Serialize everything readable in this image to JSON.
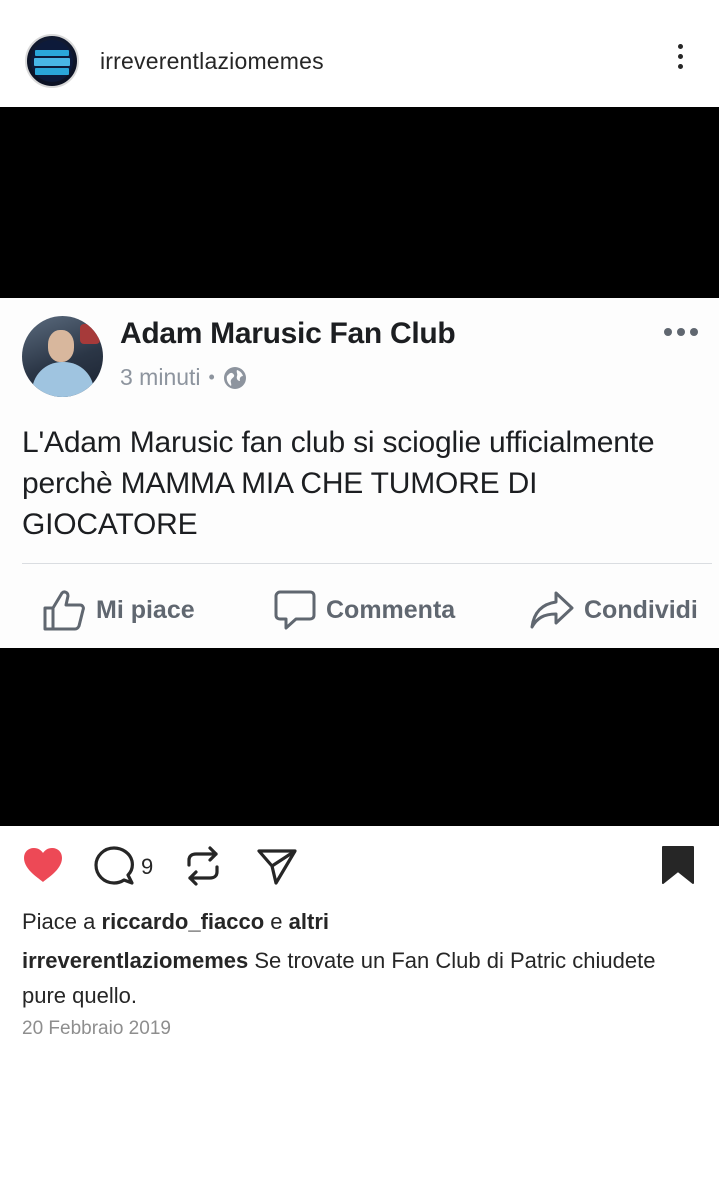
{
  "header": {
    "username": "irreverentlaziomemes",
    "avatar_icon": "profile-avatar-icon",
    "more_icon": "more-vertical-icon"
  },
  "fb_post": {
    "page_name": "Adam Marusic Fan Club",
    "time": "3 minuti",
    "separator": "•",
    "text": "L'Adam Marusic fan club si scioglie ufficialmente perchè MAMMA MIA CHE TUMORE DI GIOCATORE",
    "actions": {
      "like": "Mi piace",
      "comment": "Commenta",
      "share": "Condividi"
    },
    "colors": {
      "meta": "#8d949e",
      "action": "#606770",
      "text": "#1c1e21"
    }
  },
  "actions": {
    "liked": true,
    "comment_count": "9",
    "heart_color": "#ed4956"
  },
  "likes": {
    "prefix": "Piace a",
    "user": "riccardo_fiacco",
    "conjunction": "e",
    "others": "altri"
  },
  "caption": {
    "username": "irreverentlaziomemes",
    "text": "Se trovate un Fan Club di Patric chiudete pure quello."
  },
  "date": "20 Febbraio 2019"
}
